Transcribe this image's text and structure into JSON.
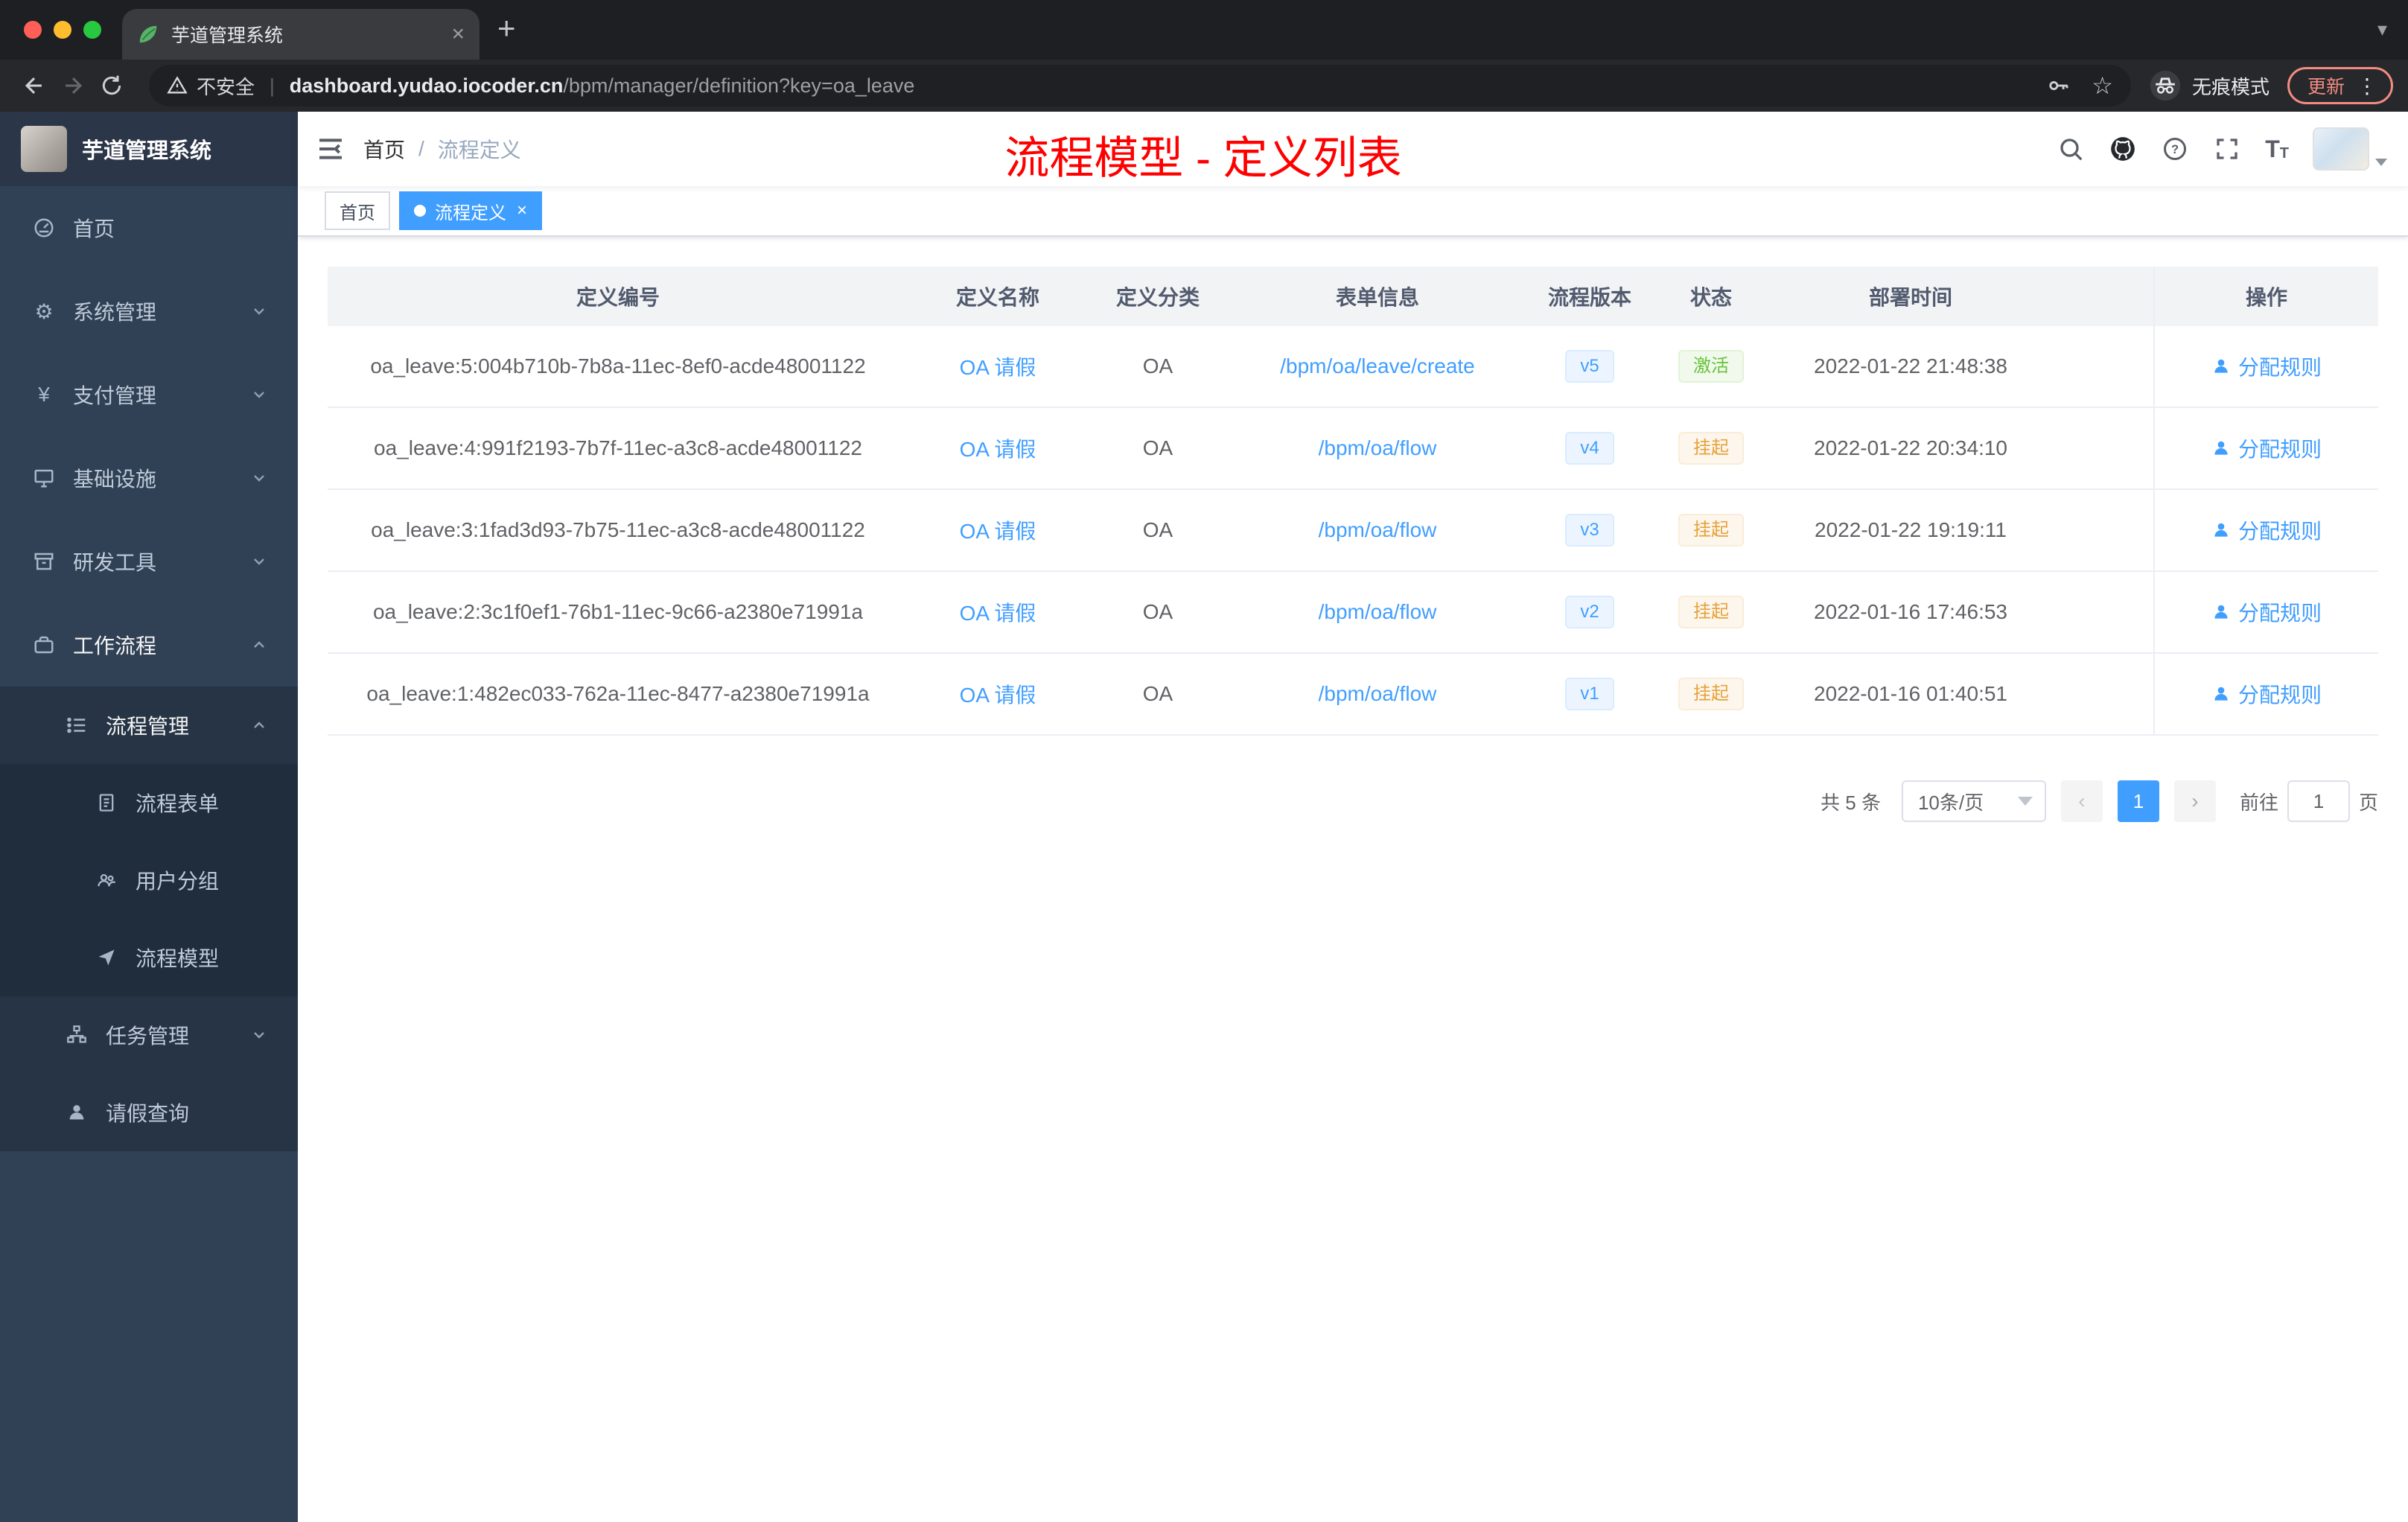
{
  "colors": {
    "accent": "#409eff",
    "sidebar-bg": "#304156",
    "success": "#67c23a",
    "warning": "#e6a23c",
    "title-red": "#ff0000"
  },
  "icons": {
    "gear": "⚙",
    "yen": "¥",
    "star": "☆",
    "more_vertical": "⋮",
    "close": "×",
    "plus": "+",
    "caret_down": "▾",
    "separator": "|",
    "font_size_letter": "T"
  },
  "browser": {
    "tab_title": "芋道管理系统",
    "not_secure_label": "不安全",
    "url_host": "dashboard.yudao.iocoder.cn",
    "url_path": "/bpm/manager/definition?key=oa_leave",
    "incognito_label": "无痕模式",
    "update_label": "更新"
  },
  "sidebar": {
    "app_title": "芋道管理系统",
    "items": [
      {
        "label": "首页"
      },
      {
        "label": "系统管理"
      },
      {
        "label": "支付管理"
      },
      {
        "label": "基础设施"
      },
      {
        "label": "研发工具"
      },
      {
        "label": "工作流程"
      },
      {
        "label": "流程管理"
      },
      {
        "label": "流程表单"
      },
      {
        "label": "用户分组"
      },
      {
        "label": "流程模型"
      },
      {
        "label": "任务管理"
      },
      {
        "label": "请假查询"
      }
    ]
  },
  "navbar": {
    "breadcrumb_home": "首页",
    "breadcrumb_separator": "/",
    "breadcrumb_current": "流程定义",
    "overlay_title": "流程模型 - 定义列表"
  },
  "tags": {
    "home_label": "首页",
    "active_label": "流程定义"
  },
  "table": {
    "headers": [
      "定义编号",
      "定义名称",
      "定义分类",
      "表单信息",
      "流程版本",
      "状态",
      "部署时间",
      "操作"
    ],
    "action_label": "分配规则",
    "rows": [
      {
        "id": "oa_leave:5:004b710b-7b8a-11ec-8ef0-acde48001122",
        "name": "OA 请假",
        "category": "OA",
        "form": "/bpm/oa/leave/create",
        "version": "v5",
        "status": "激活",
        "status_type": "success",
        "time": "2022-01-22 21:48:38"
      },
      {
        "id": "oa_leave:4:991f2193-7b7f-11ec-a3c8-acde48001122",
        "name": "OA 请假",
        "category": "OA",
        "form": "/bpm/oa/flow",
        "version": "v4",
        "status": "挂起",
        "status_type": "warning",
        "time": "2022-01-22 20:34:10"
      },
      {
        "id": "oa_leave:3:1fad3d93-7b75-11ec-a3c8-acde48001122",
        "name": "OA 请假",
        "category": "OA",
        "form": "/bpm/oa/flow",
        "version": "v3",
        "status": "挂起",
        "status_type": "warning",
        "time": "2022-01-22 19:19:11"
      },
      {
        "id": "oa_leave:2:3c1f0ef1-76b1-11ec-9c66-a2380e71991a",
        "name": "OA 请假",
        "category": "OA",
        "form": "/bpm/oa/flow",
        "version": "v2",
        "status": "挂起",
        "status_type": "warning",
        "time": "2022-01-16 17:46:53"
      },
      {
        "id": "oa_leave:1:482ec033-762a-11ec-8477-a2380e71991a",
        "name": "OA 请假",
        "category": "OA",
        "form": "/bpm/oa/flow",
        "version": "v1",
        "status": "挂起",
        "status_type": "warning",
        "time": "2022-01-16 01:40:51"
      }
    ]
  },
  "pagination": {
    "total": "共 5 条",
    "page_size": "10条/页",
    "current_page": "1",
    "goto_label": "前往",
    "goto_value": "1",
    "page_unit": "页"
  }
}
